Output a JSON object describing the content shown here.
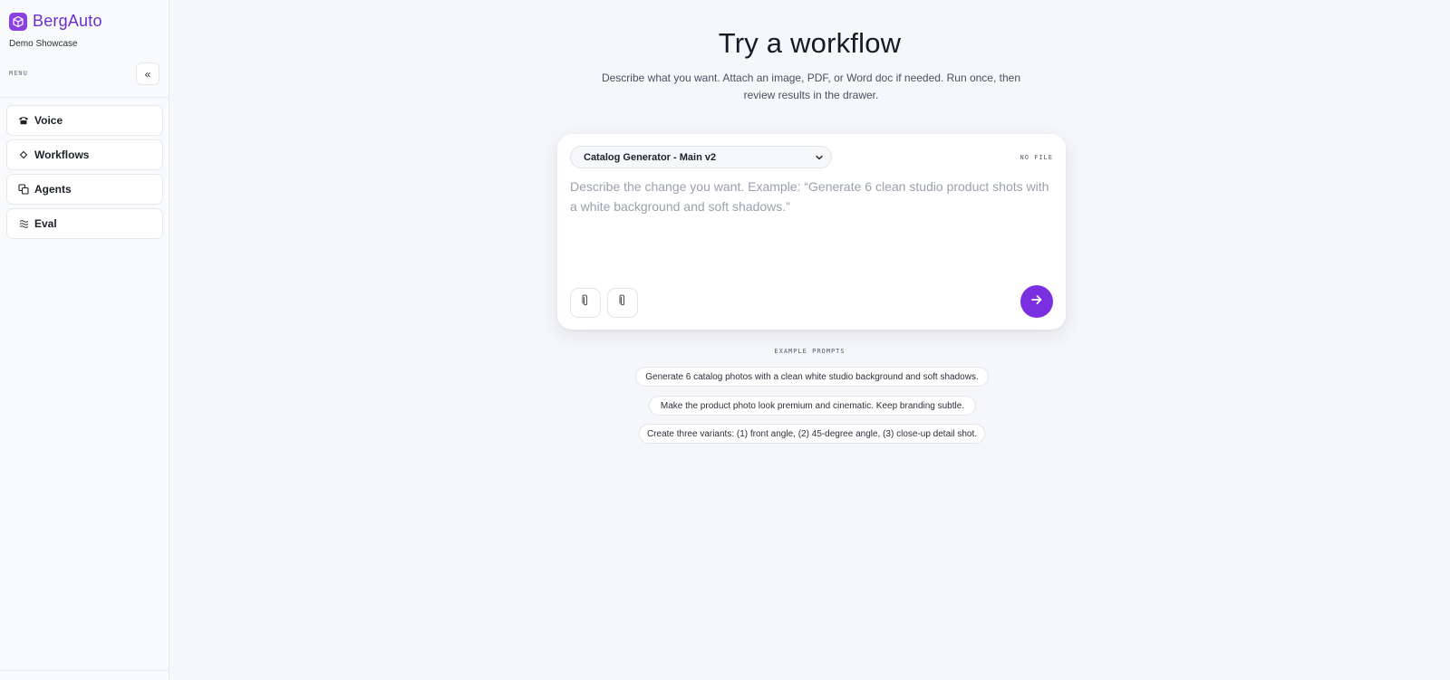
{
  "brand": {
    "name": "BergAuto",
    "subtitle": "Demo Showcase",
    "accent_color": "#7a2fe0",
    "logo_icon": "cube-icon"
  },
  "sidebar": {
    "menu_label": "MENU",
    "collapse_label": "«",
    "items": [
      {
        "label": "Voice",
        "icon": "phone-icon"
      },
      {
        "label": "Workflows",
        "icon": "diamond-icon"
      },
      {
        "label": "Agents",
        "icon": "copy-icon"
      },
      {
        "label": "Eval",
        "icon": "waves-icon"
      }
    ]
  },
  "main": {
    "title": "Try a workflow",
    "description": "Describe what you want. Attach an image, PDF, or Word doc if needed. Run once, then review results in the drawer.",
    "composer": {
      "workflow_selected": "Catalog Generator - Main v2",
      "file_status": "NO FILE",
      "placeholder": "Describe the change you want. Example: “Generate 6 clean studio product shots with a white background and soft shadows.”",
      "attach_icons": [
        "paperclip-icon",
        "paperclip-icon"
      ],
      "send_icon": "arrow-right-icon"
    },
    "examples_label": "EXAMPLE PROMPTS",
    "examples": [
      "Generate 6 catalog photos with a clean white studio background and soft shadows.",
      "Make the product photo look premium and cinematic. Keep branding subtle.",
      "Create three variants: (1) front angle, (2) 45-degree angle, (3) close-up detail shot."
    ]
  }
}
